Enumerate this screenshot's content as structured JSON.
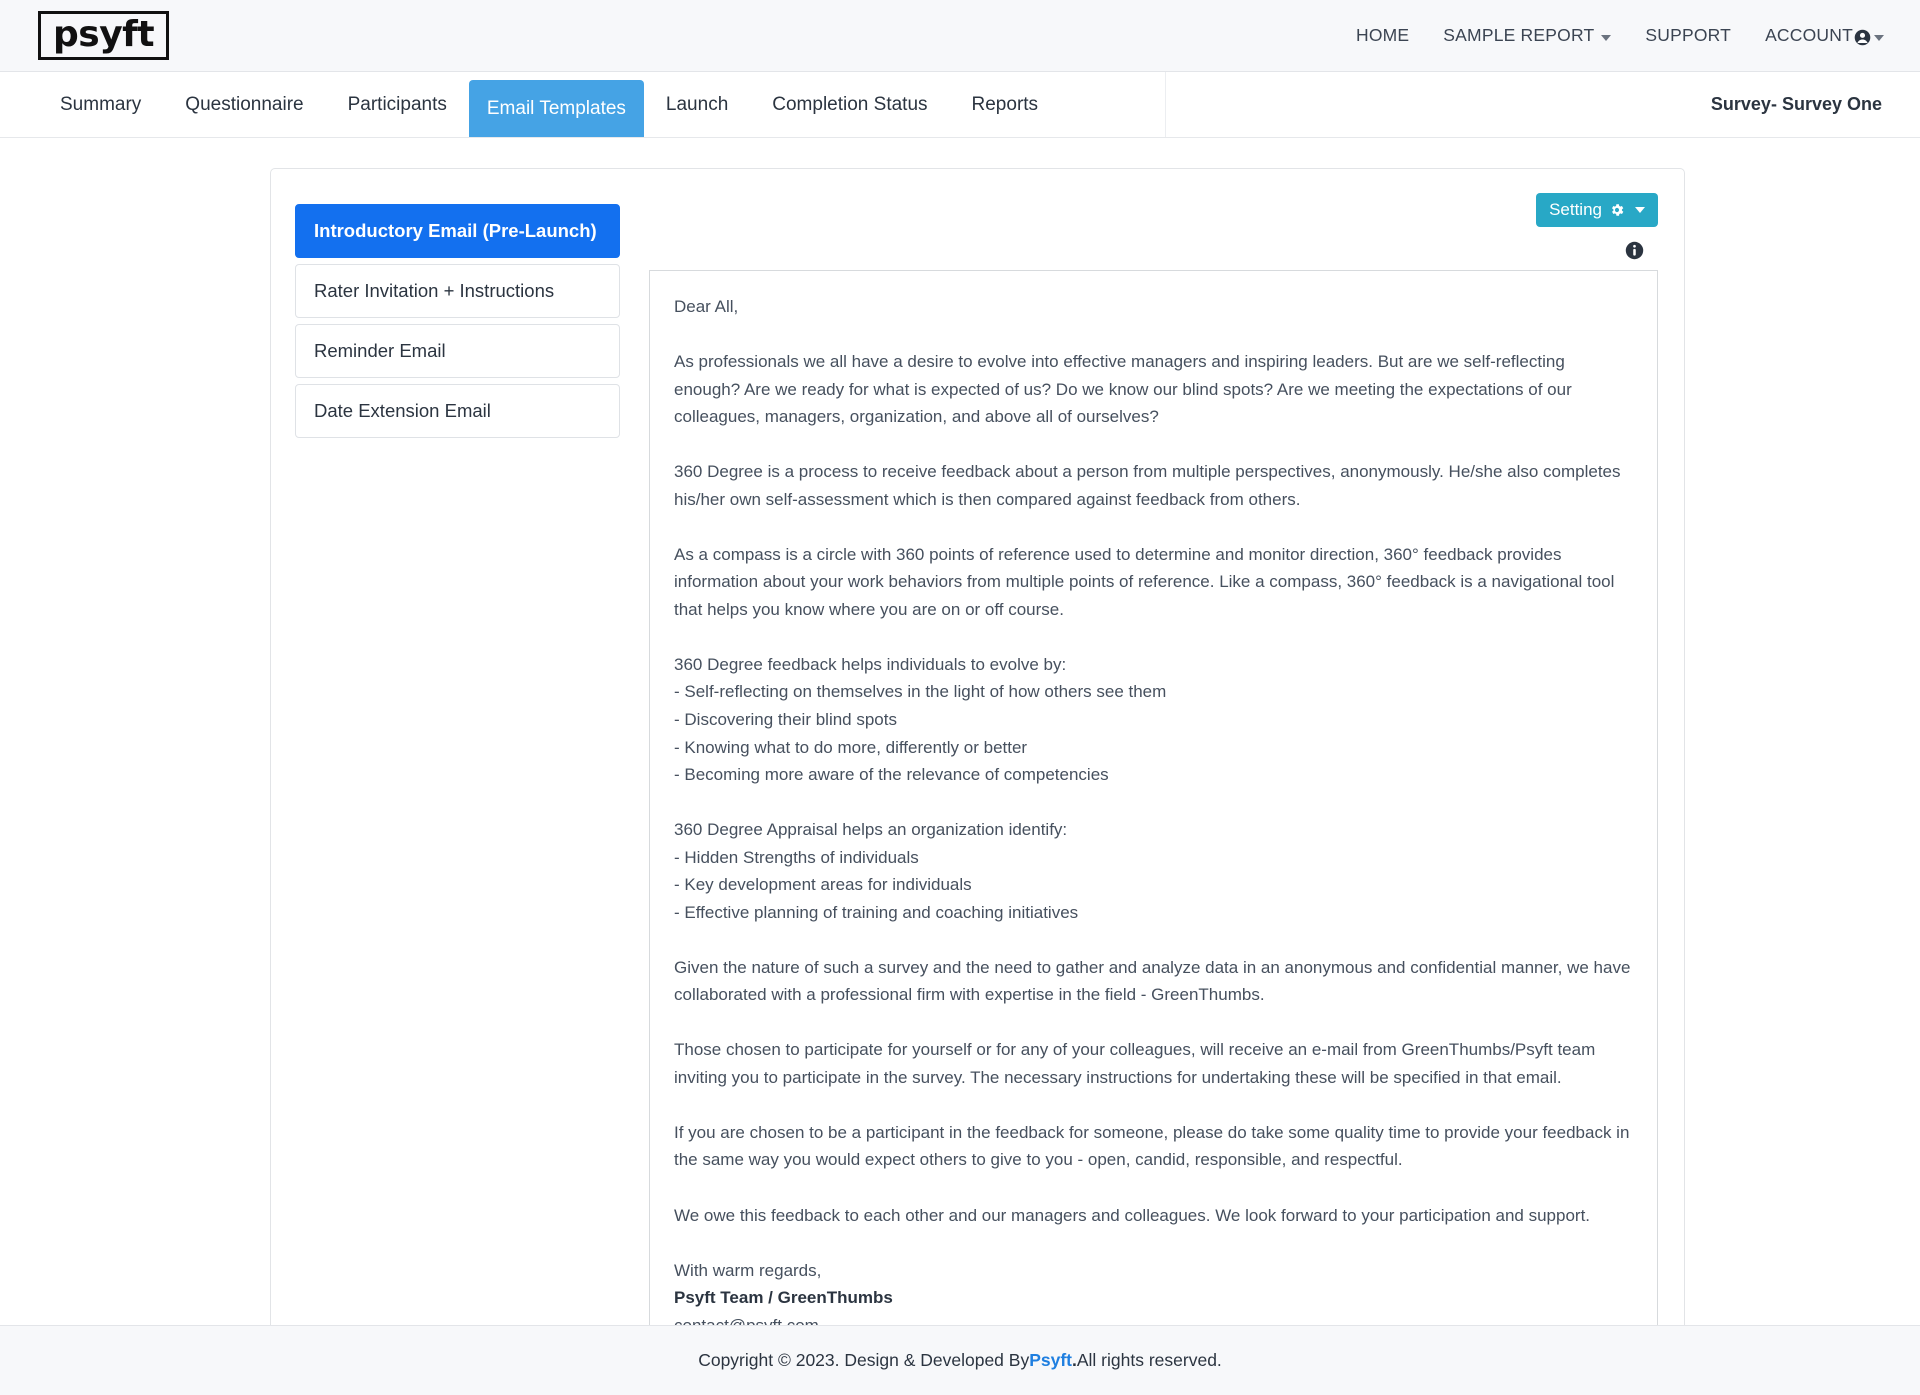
{
  "brand": {
    "logo_text": "psyft",
    "accent_blue": "#1370ef",
    "tab_blue": "#45a3e5",
    "setting_teal": "#28a8c6",
    "link_blue": "#1f7fe0"
  },
  "topnav": {
    "items": [
      {
        "label": "HOME",
        "caret": false,
        "icon": ""
      },
      {
        "label": "SAMPLE REPORT",
        "caret": true,
        "icon": ""
      },
      {
        "label": "SUPPORT",
        "caret": false,
        "icon": ""
      },
      {
        "label": "ACCOUNT",
        "caret": true,
        "icon": "user-circle-icon"
      }
    ]
  },
  "tabs": {
    "items": [
      {
        "label": "Summary",
        "active": false
      },
      {
        "label": "Questionnaire",
        "active": false
      },
      {
        "label": "Participants",
        "active": false
      },
      {
        "label": "Email Templates",
        "active": true
      },
      {
        "label": "Launch",
        "active": false
      },
      {
        "label": "Completion Status",
        "active": false
      },
      {
        "label": "Reports",
        "active": false
      }
    ],
    "survey_title": "Survey- Survey One"
  },
  "sidebar": {
    "items": [
      {
        "label": "Introductory Email (Pre-Launch)",
        "active": true
      },
      {
        "label": "Rater Invitation + Instructions",
        "active": false
      },
      {
        "label": "Reminder Email",
        "active": false
      },
      {
        "label": "Date Extension Email",
        "active": false
      }
    ]
  },
  "toolbar": {
    "setting_label": "Setting",
    "setting_icon": "gear-icon",
    "info_icon": "info-circle-icon"
  },
  "email": {
    "body": "Dear All,\n\nAs professionals we all have a desire to evolve into effective managers and inspiring leaders. But are we self-reflecting enough? Are we ready for what is expected of us? Do we know our blind spots? Are we meeting the expectations of our colleagues, managers, organization, and above all of ourselves?\n\n360 Degree is a process to receive feedback about a person from multiple perspectives, anonymously. He/she also completes his/her own self-assessment which is then compared against feedback from others.\n\nAs a compass is a circle with 360 points of reference used to determine and monitor direction, 360° feedback provides information about your work behaviors from multiple points of reference. Like a compass, 360° feedback is a navigational tool that helps you know where you are on or off course.\n\n360 Degree feedback helps individuals to evolve by:\n- Self-reflecting on themselves in the light of how others see them\n- Discovering their blind spots\n- Knowing what to do more, differently or better\n- Becoming more aware of the relevance of competencies\n\n360 Degree Appraisal helps an organization identify:\n- Hidden Strengths of individuals\n- Key development areas for individuals\n- Effective planning of training and coaching initiatives\n\nGiven the nature of such a survey and the need to gather and analyze data in an anonymous and confidential manner, we have collaborated with a professional firm with expertise in the field - GreenThumbs.\n\nThose chosen to participate for yourself or for any of your colleagues, will receive an e-mail from GreenThumbs/Psyft team inviting you to participate in the survey. The necessary instructions for undertaking these will be specified in that email.\n\nIf you are chosen to be a participant in the feedback for someone, please do take some quality time to provide your feedback in the same way you would expect others to give to you - open, candid, responsible, and respectful.\n\nWe owe this feedback to each other and our managers and colleagues. We look forward to your participation and support.\n\nWith warm regards,",
    "signature_name": "Psyft Team / GreenThumbs",
    "signature_email": "contact@psyft.com"
  },
  "footer": {
    "prefix": "Copyright © 2023. Design & Developed By ",
    "brand": "Psyft",
    "suffix": " All rights reserved.",
    "period": "."
  }
}
